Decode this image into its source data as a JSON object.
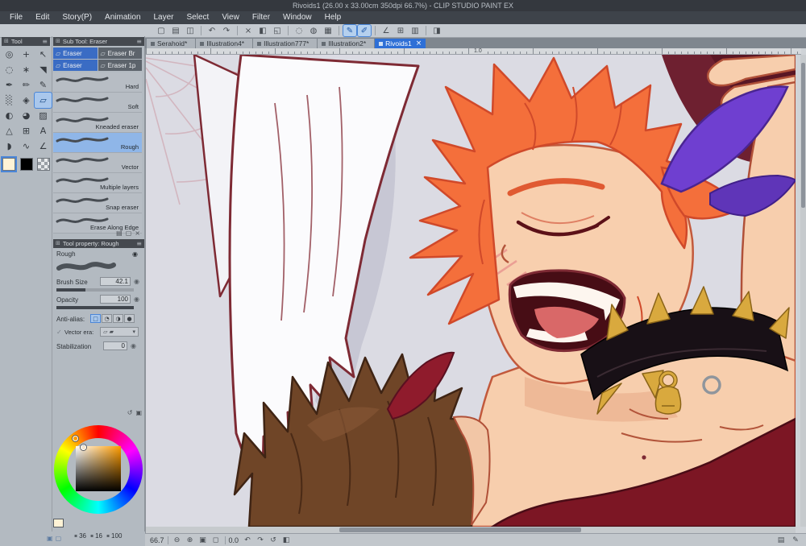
{
  "colors": {
    "titlebar": "#34383e",
    "menubar": "#3e434a",
    "panel": "#b3bac1",
    "panel_header": "#45494f",
    "accent_blue": "#4a86d8",
    "tab_active": "#2e6fd6",
    "selection_light": "#9dc0ea",
    "canvas_bg": "#dbdbe3",
    "main_color": "#fff3d6",
    "sub_color": "#000000"
  },
  "window": {
    "title": "Rivoids1 (26.00 x 33.00cm 350dpi 66.7%) - CLIP STUDIO PAINT EX"
  },
  "menubar": {
    "items": [
      {
        "label": "File"
      },
      {
        "label": "Edit"
      },
      {
        "label": "Story(P)"
      },
      {
        "label": "Animation"
      },
      {
        "label": "Layer"
      },
      {
        "label": "Select"
      },
      {
        "label": "View"
      },
      {
        "label": "Filter"
      },
      {
        "label": "Window"
      },
      {
        "label": "Help"
      }
    ]
  },
  "toolbar": {
    "icons": [
      {
        "name": "new-canvas-icon",
        "glyph": "▢"
      },
      {
        "name": "open-file-icon",
        "glyph": "▤"
      },
      {
        "name": "save-icon",
        "glyph": "◫"
      },
      {
        "name": "toolbar-separator",
        "glyph": "",
        "sep": true
      },
      {
        "name": "undo-icon",
        "glyph": "↶"
      },
      {
        "name": "redo-icon",
        "glyph": "↷"
      },
      {
        "name": "toolbar-separator",
        "glyph": "",
        "sep": true
      },
      {
        "name": "delete-icon",
        "glyph": "×"
      },
      {
        "name": "fill-icon",
        "glyph": "◧"
      },
      {
        "name": "scale-rotate-icon",
        "glyph": "◱"
      },
      {
        "name": "toolbar-separator",
        "glyph": "",
        "sep": true
      },
      {
        "name": "deselect-icon",
        "glyph": "◌"
      },
      {
        "name": "invert-selection-icon",
        "glyph": "◍"
      },
      {
        "name": "selection-border-icon",
        "glyph": "▦"
      },
      {
        "name": "toolbar-separator",
        "glyph": "",
        "sep": true
      },
      {
        "name": "snap-to-ruler-icon",
        "glyph": "✎",
        "active": true
      },
      {
        "name": "snap-to-special-ruler-icon",
        "glyph": "✐",
        "active": true
      },
      {
        "name": "toolbar-separator",
        "glyph": "",
        "sep": true
      },
      {
        "name": "ruler-icon",
        "glyph": "∠"
      },
      {
        "name": "grid-icon",
        "glyph": "⊞"
      },
      {
        "name": "material-icon",
        "glyph": "▥"
      },
      {
        "name": "toolbar-separator",
        "glyph": "",
        "sep": true
      },
      {
        "name": "workspace-icon",
        "glyph": "◨"
      }
    ]
  },
  "tabs": [
    {
      "label": "Serahoid*",
      "close": ""
    },
    {
      "label": "Illustration4*",
      "close": ""
    },
    {
      "label": "Illustration777*",
      "close": ""
    },
    {
      "label": "Illustration2*",
      "close": ""
    },
    {
      "label": "Rivoids1",
      "active": true,
      "close": "×"
    }
  ],
  "panels": {
    "grid_glyph": "⊞",
    "menu_glyph": "≡"
  },
  "tool_panel": {
    "title": "Tool",
    "tools": [
      {
        "name": "zoom-tool-icon",
        "glyph": "◎"
      },
      {
        "name": "move-tool-icon",
        "glyph": "+"
      },
      {
        "name": "operation-tool-icon",
        "glyph": "↖"
      },
      {
        "name": "selection-tool-icon",
        "glyph": "◌"
      },
      {
        "name": "auto-select-tool-icon",
        "glyph": "∗"
      },
      {
        "name": "eyedropper-tool-icon",
        "glyph": "◥"
      },
      {
        "name": "pen-tool-icon",
        "glyph": "✒"
      },
      {
        "name": "pencil-tool-icon",
        "glyph": "✏"
      },
      {
        "name": "brush-tool-icon",
        "glyph": "✎"
      },
      {
        "name": "airbrush-tool-icon",
        "glyph": "░"
      },
      {
        "name": "decoration-tool-icon",
        "glyph": "◈"
      },
      {
        "name": "eraser-tool-icon",
        "glyph": "▱",
        "selected": true
      },
      {
        "name": "blend-tool-icon",
        "glyph": "◐"
      },
      {
        "name": "fill-tool-icon",
        "glyph": "◕"
      },
      {
        "name": "gradient-tool-icon",
        "glyph": "▨"
      },
      {
        "name": "figure-tool-icon",
        "glyph": "△"
      },
      {
        "name": "frame-border-tool-icon",
        "glyph": "⊞"
      },
      {
        "name": "text-tool-icon",
        "glyph": "A"
      },
      {
        "name": "balloon-tool-icon",
        "glyph": "◗"
      },
      {
        "name": "line-correction-tool-icon",
        "glyph": "∿"
      },
      {
        "name": "ruler-tool-icon",
        "glyph": "∠"
      }
    ]
  },
  "subtool_panel": {
    "title": "Sub Tool: Eraser",
    "group_glyph": "▱",
    "groups": [
      {
        "label": "Eraser",
        "selected": true
      },
      {
        "label": "Eraser Br"
      },
      {
        "label": "Eraser",
        "selected": true
      },
      {
        "label": "Eraser 1p"
      }
    ],
    "presets": [
      {
        "label": "Hard"
      },
      {
        "label": "Soft"
      },
      {
        "label": "Kneaded eraser"
      },
      {
        "label": "Rough",
        "selected": true
      },
      {
        "label": "Vector"
      },
      {
        "label": "Multiple layers"
      },
      {
        "label": "Snap eraser"
      },
      {
        "label": "Erase Along Edge"
      }
    ],
    "footer_icons": [
      {
        "name": "new-subtool-group-icon",
        "glyph": "▤"
      },
      {
        "name": "new-subtool-icon",
        "glyph": "▢"
      },
      {
        "name": "delete-subtool-icon",
        "glyph": "×"
      }
    ]
  },
  "tool_property": {
    "title": "Tool property: Rough",
    "preset_name": "Rough",
    "lock_glyph": "◉",
    "brush_size_label": "Brush Size",
    "brush_size": "42.1",
    "opacity_label": "Opacity",
    "opacity": "100",
    "anti_alias_label": "Anti-alias:",
    "anti_alias_options": [
      {
        "name": "aa-none-icon",
        "glyph": "□",
        "selected": true
      },
      {
        "name": "aa-weak-icon",
        "glyph": "◔"
      },
      {
        "name": "aa-middle-icon",
        "glyph": "◑"
      },
      {
        "name": "aa-strong-icon",
        "glyph": "●"
      }
    ],
    "vector_check_glyph": "✓",
    "vector_label": "Vector era:",
    "vector_options_glyph": "▱ ▰",
    "vector_caret": "▾",
    "stabilization_label": "Stabilization",
    "stabilization": "0",
    "spinner_glyph": "◉",
    "footer_icons": [
      {
        "name": "reset-settings-icon",
        "glyph": "↺"
      },
      {
        "name": "register-settings-icon",
        "glyph": "▣"
      }
    ]
  },
  "color_panel": {
    "values": [
      {
        "name": "hue-value",
        "icon": "▪",
        "value": "36"
      },
      {
        "name": "saturation-value",
        "icon": "▪",
        "value": "16"
      },
      {
        "name": "value-value",
        "icon": "▪",
        "value": "100"
      }
    ]
  },
  "panel_strip": {
    "icons": [
      {
        "name": "window-thumbnail-icon-1",
        "glyph": "▣"
      },
      {
        "name": "window-thumbnail-icon-2",
        "glyph": "▢"
      }
    ]
  },
  "canvas": {
    "ruler_label": "1.0"
  },
  "statusbar": {
    "zoom": "66.7",
    "rotation": "0.0",
    "zoom_icons": [
      {
        "name": "zoom-out-icon",
        "glyph": "⊖"
      },
      {
        "name": "zoom-in-icon",
        "glyph": "⊕"
      },
      {
        "name": "fit-screen-icon",
        "glyph": "▣"
      },
      {
        "name": "actual-size-icon",
        "glyph": "◻"
      }
    ],
    "rotate_icons": [
      {
        "name": "rotate-ccw-icon",
        "glyph": "↶"
      },
      {
        "name": "rotate-cw-icon",
        "glyph": "↷"
      },
      {
        "name": "reset-rotation-icon",
        "glyph": "↺"
      },
      {
        "name": "flip-horizontal-icon",
        "glyph": "◧"
      }
    ],
    "right_icons": [
      {
        "name": "material-panel-icon",
        "glyph": "▤"
      },
      {
        "name": "edit-mode-icon",
        "glyph": "✎"
      }
    ]
  }
}
